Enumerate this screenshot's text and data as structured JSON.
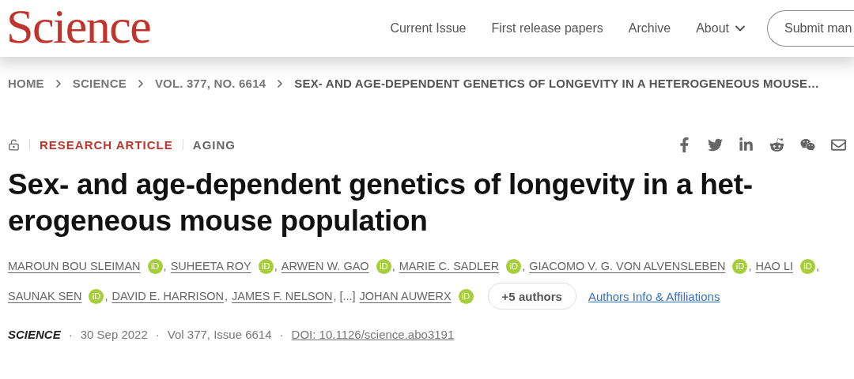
{
  "header": {
    "logo": "Science",
    "nav": [
      {
        "label": "Current Issue",
        "kind": "link"
      },
      {
        "label": "First release papers",
        "kind": "link"
      },
      {
        "label": "Archive",
        "kind": "link"
      },
      {
        "label": "About",
        "kind": "menu"
      }
    ],
    "submit": "Submit man"
  },
  "breadcrumb": [
    {
      "label": "HOME",
      "current": false
    },
    {
      "label": "SCIENCE",
      "current": false
    },
    {
      "label": "VOL. 377, NO. 6614",
      "current": false
    },
    {
      "label": "SEX- AND AGE-DEPENDENT GENETICS OF LONGEVITY IN A HETEROGENEOUS MOUSE…",
      "current": true
    }
  ],
  "article_type": "RESEARCH ARTICLE",
  "subject": "AGING",
  "title_lines": [
    "Sex- and age-dependent genetics of longevity in a het-",
    "erogeneous mouse population"
  ],
  "author_lines": [
    [
      {
        "name": "MAROUN BOU SLEIMAN",
        "badge": "iD",
        "after": ","
      },
      {
        "name": "SUHEETA ROY",
        "badge": "iD",
        "after": ","
      },
      {
        "name": "ARWEN W. GAO",
        "badge": "iD",
        "after": ","
      },
      {
        "name": "MARIE C. SADLER",
        "badge": "iD",
        "after": ","
      },
      {
        "name": "GIACOMO V. G. VON ALVENSLEBEN",
        "badge": "iD",
        "after": ","
      },
      {
        "name": "HAO LI",
        "badge": "iD",
        "after": ","
      }
    ],
    [
      {
        "name": "SAUNAK SEN",
        "badge": "iD",
        "after": ","
      },
      {
        "name": "DAVID E. HARRISON",
        "after": ","
      },
      {
        "name": "JAMES F. NELSON",
        "after": ", [...]"
      },
      {
        "name": "JOHAN AUWERX",
        "badge": "iD"
      }
    ]
  ],
  "more_authors": "+5 authors",
  "affiliations_link": "Authors Info & Affiliations",
  "meta": [
    {
      "kind": "journal",
      "text": "SCIENCE"
    },
    {
      "kind": "separator",
      "text": "·"
    },
    {
      "kind": "text",
      "text": "30 Sep 2022"
    },
    {
      "kind": "separator",
      "text": "·"
    },
    {
      "kind": "text",
      "text": "Vol 377, Issue 6614"
    },
    {
      "kind": "separator",
      "text": "·"
    },
    {
      "kind": "link",
      "text": "DOI: 10.1126/science.abo3191"
    }
  ]
}
